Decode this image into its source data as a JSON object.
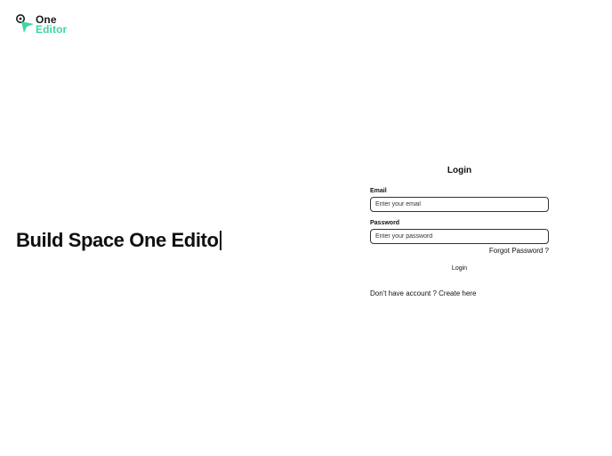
{
  "brand": {
    "name_line1": "One",
    "name_line2": "Editor",
    "accent_color": "#3ed6a0",
    "logo_icon": "location-pin-logo-icon"
  },
  "hero": {
    "typed_text": "Build Space One Edito"
  },
  "login": {
    "title": "Login",
    "email_label": "Email",
    "email_placeholder": "Enter your email",
    "email_value": "",
    "password_label": "Password",
    "password_placeholder": "Enter your password",
    "password_value": "",
    "forgot_password": "Forgot Password ?",
    "submit_label": "Login",
    "signup_prompt": "Don't have account ?",
    "signup_link": "Create here"
  }
}
